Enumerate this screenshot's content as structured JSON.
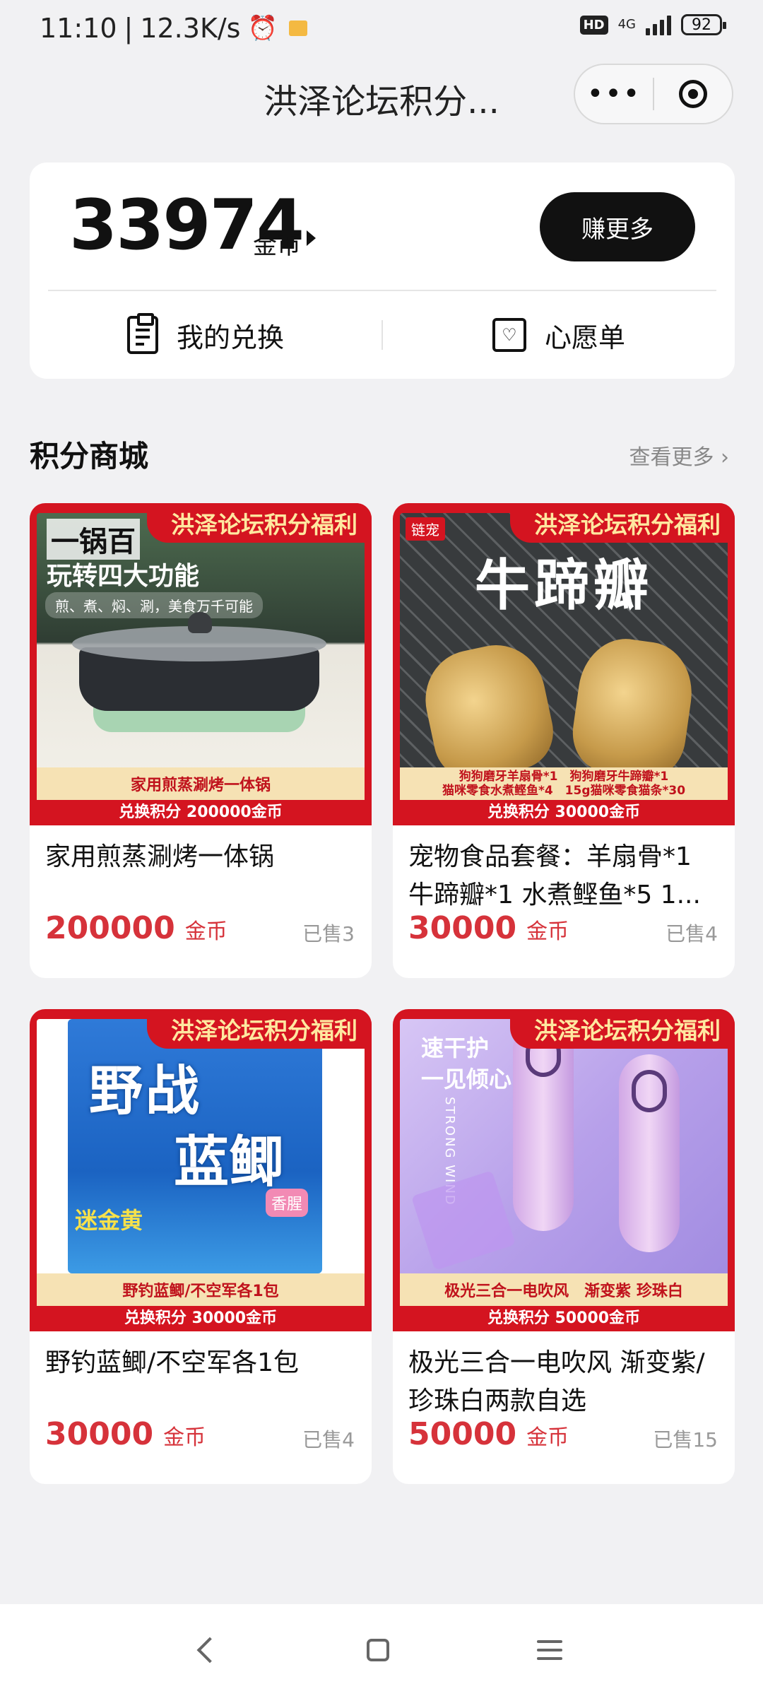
{
  "status": {
    "time": "11:10",
    "speed": "12.3K/s",
    "hd": "HD",
    "network": "4G",
    "battery": "92"
  },
  "header": {
    "title": "洪泽论坛积分...",
    "more_icon": "more-dots-icon",
    "close_icon": "target-icon"
  },
  "points": {
    "value": "33974",
    "unit": "金币",
    "earn_label": "赚更多",
    "my_redeem_label": "我的兑换",
    "wishlist_label": "心愿单"
  },
  "section": {
    "title": "积分商城",
    "see_more": "查看更多"
  },
  "products": [
    {
      "promo": "洪泽论坛积分福利",
      "img_line1": "一锅百",
      "img_line2": "玩转四大功能",
      "img_line3": "煎、煮、焖、涮，美食万千可能",
      "caption": "家用煎蒸涮烤一体锅",
      "redeem": "兑换积分 200000金币",
      "name": "家用煎蒸涮烤一体锅",
      "price": "200000",
      "unit": "金币",
      "sold": "已售3"
    },
    {
      "promo": "洪泽论坛积分福利",
      "logo": "链宠",
      "img_title": "牛蹄瓣",
      "caption_line1": "狗狗磨牙羊扇骨*1　狗狗磨牙牛蹄瓣*1",
      "caption_line2": "猫咪零食水煮鲣鱼*4　15g猫咪零食猫条*30",
      "redeem": "兑换积分 30000金币",
      "name": "宠物食品套餐：羊扇骨*1 牛蹄瓣*1 水煮鲣鱼*5 1...",
      "price": "30000",
      "unit": "金币",
      "sold": "已售4"
    },
    {
      "promo": "洪泽论坛积分福利",
      "img_line1": "野战",
      "img_line2": "蓝鲫",
      "img_badge": "香腥",
      "img_yellow": "迷金黄",
      "caption": "野钓蓝鲫/不空军各1包",
      "redeem": "兑换积分 30000金币",
      "name": "野钓蓝鲫/不空军各1包",
      "price": "30000",
      "unit": "金币",
      "sold": "已售4"
    },
    {
      "promo": "洪泽论坛积分福利",
      "img_line1": "速干护",
      "img_line2": "一见倾心",
      "img_wind": "STRONG WIND",
      "caption": "极光三合一电吹风　渐变紫 珍珠白",
      "redeem": "兑换积分 50000金币",
      "name": "极光三合一电吹风 渐变紫/珍珠白两款自选",
      "price": "50000",
      "unit": "金币",
      "sold": "已售15"
    }
  ],
  "nav": {
    "back_icon": "back-icon",
    "home_icon": "home-icon",
    "menu_icon": "menu-icon"
  }
}
